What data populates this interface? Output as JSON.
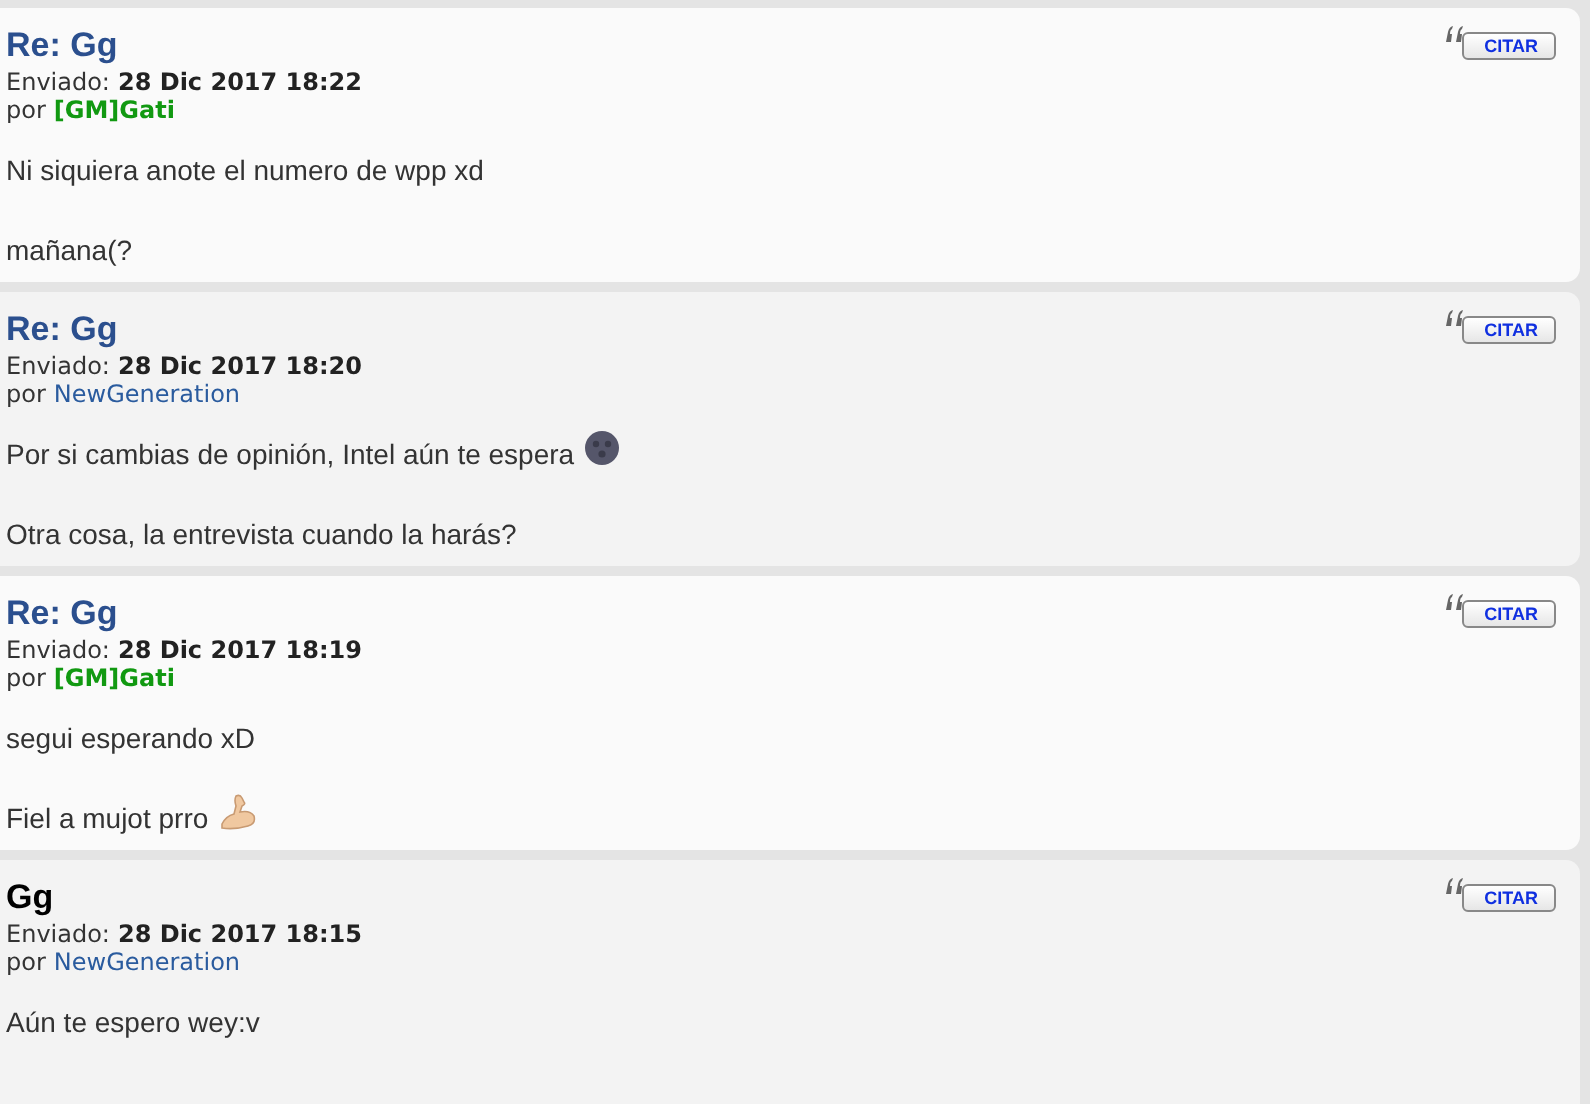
{
  "posts": [
    {
      "kind": "reply",
      "title": "Re: Gg",
      "sent_label": "Enviado:",
      "date": "28 Dic 2017 18:22",
      "by_label": "por",
      "author": {
        "name": "[GM]Gati",
        "color": "#119911",
        "bold": true
      },
      "quote_button": "CITAR",
      "lines": [
        {
          "kind": "plain",
          "text": "Ni siquiera anote el numero de wpp xd"
        },
        {
          "kind": "plain",
          "text": "mañana(?"
        }
      ]
    },
    {
      "kind": "reply",
      "title": "Re: Gg",
      "sent_label": "Enviado:",
      "date": "28 Dic 2017 18:20",
      "by_label": "por",
      "author": {
        "name": "NewGeneration",
        "color": "#2a5b9e",
        "bold": false
      },
      "quote_button": "CITAR",
      "lines": [
        {
          "kind": "moon",
          "text": "Por si cambias de opinión, Intel aún te espera"
        },
        {
          "kind": "plain",
          "text": "Otra cosa, la entrevista cuando la harás?"
        }
      ]
    },
    {
      "kind": "reply",
      "title": "Re: Gg",
      "sent_label": "Enviado:",
      "date": "28 Dic 2017 18:19",
      "by_label": "por",
      "author": {
        "name": "[GM]Gati",
        "color": "#119911",
        "bold": true
      },
      "quote_button": "CITAR",
      "lines": [
        {
          "kind": "plain",
          "text": "segui esperando xD"
        },
        {
          "kind": "arm",
          "text": "Fiel a mujot prro"
        }
      ]
    },
    {
      "kind": "topic",
      "title": "Gg",
      "sent_label": "Enviado:",
      "date": "28 Dic 2017 18:15",
      "by_label": "por",
      "author": {
        "name": "NewGeneration",
        "color": "#2a5b9e",
        "bold": false
      },
      "quote_button": "CITAR",
      "lines": [
        {
          "kind": "plain",
          "text": "Aún te espero wey:v"
        }
      ]
    }
  ]
}
